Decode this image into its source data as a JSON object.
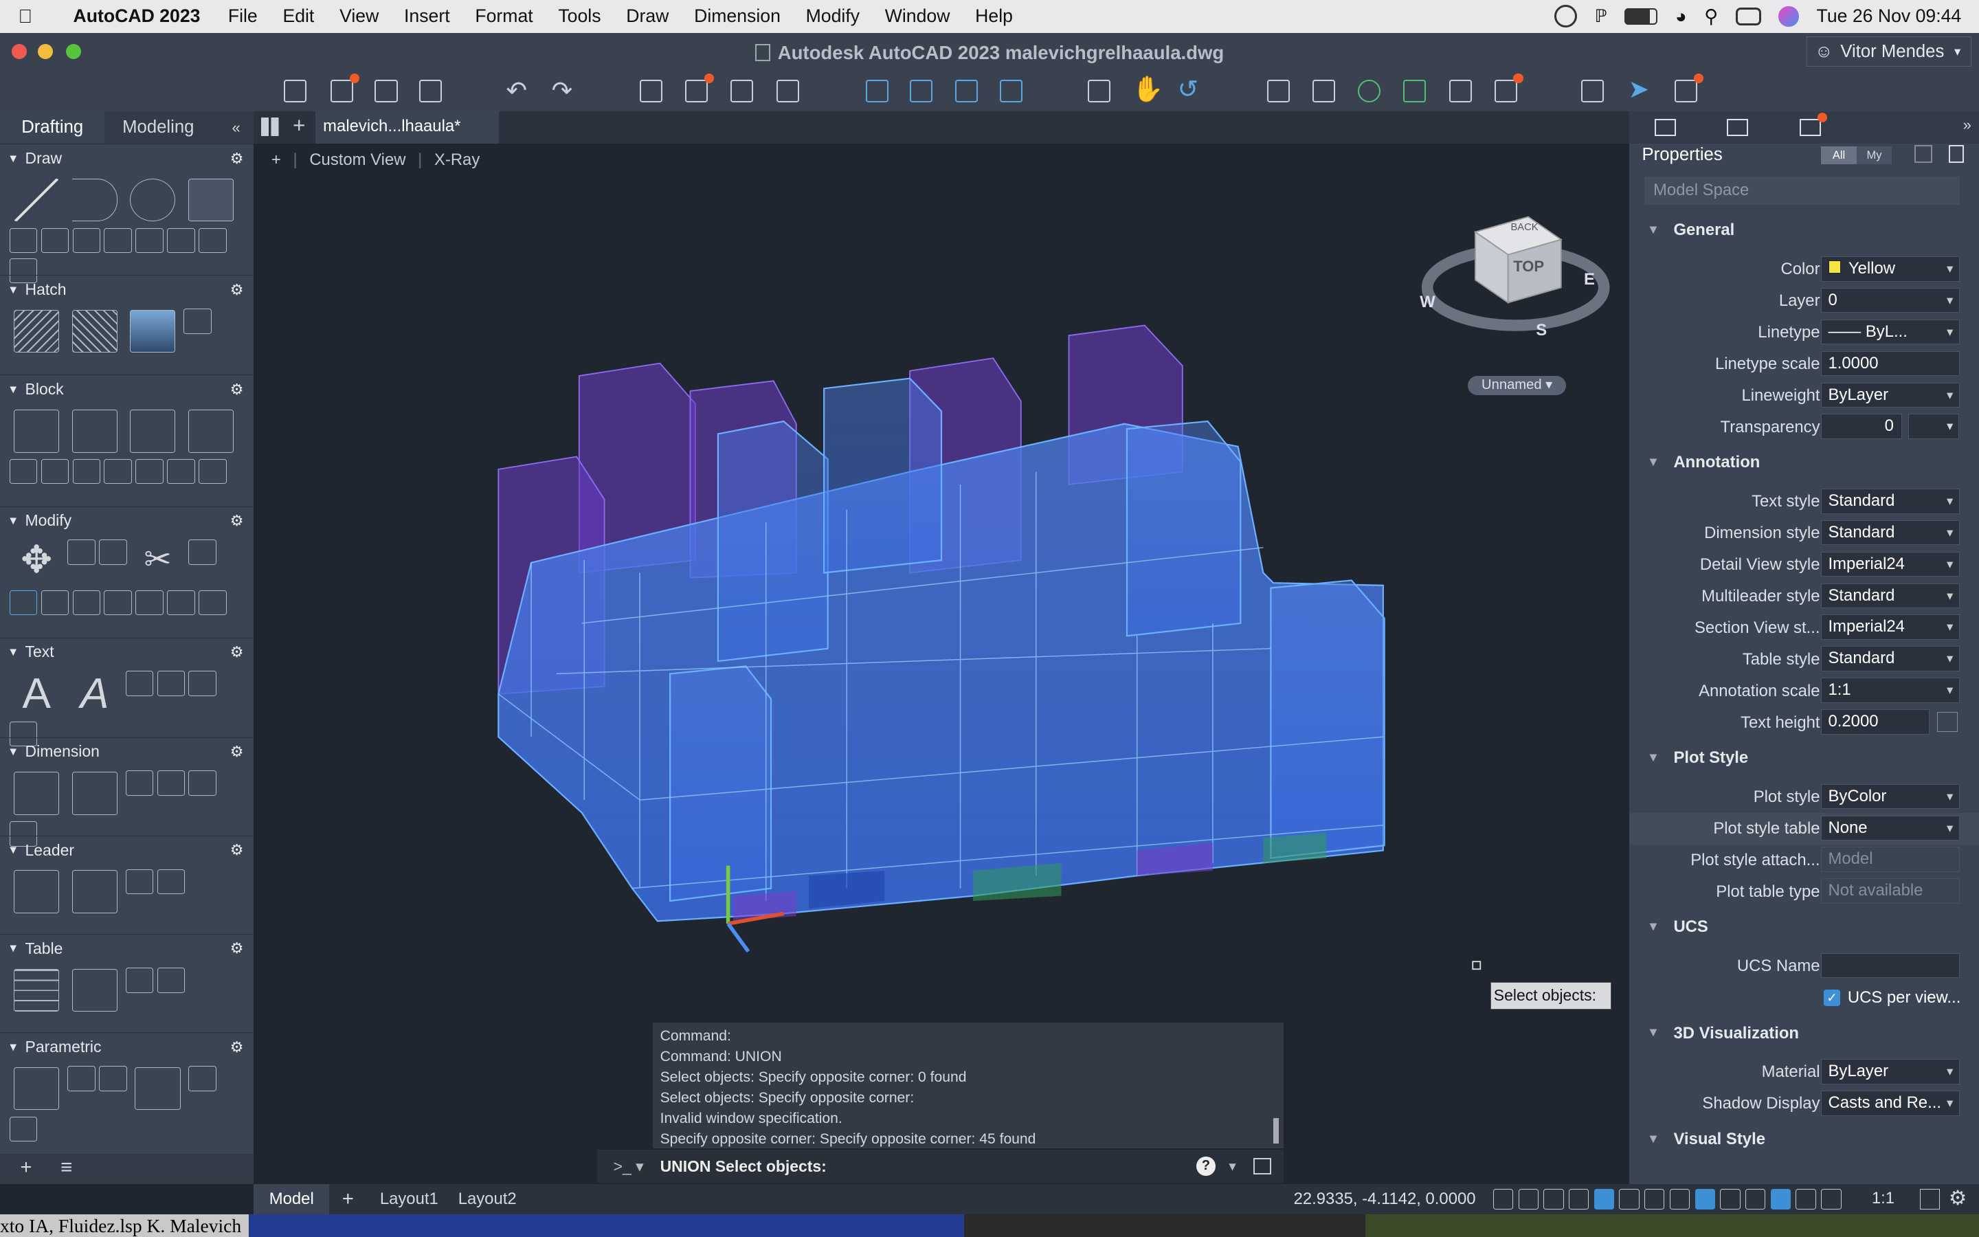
{
  "menubar": {
    "app": "AutoCAD 2023",
    "items": [
      "File",
      "Edit",
      "View",
      "Insert",
      "Format",
      "Tools",
      "Draw",
      "Dimension",
      "Modify",
      "Window",
      "Help"
    ],
    "datetime": "Tue 26 Nov  09:44"
  },
  "window": {
    "title": "Autodesk AutoCAD 2023   malevichgrelhaaula.dwg",
    "user": "Vitor Mendes"
  },
  "palette": {
    "tabs": [
      "Drafting",
      "Modeling"
    ],
    "sections": [
      "Draw",
      "Hatch",
      "Block",
      "Modify",
      "Text",
      "Dimension",
      "Leader",
      "Table",
      "Parametric"
    ]
  },
  "doc": {
    "tab": "malevich...lhaaula*",
    "view_plus": "+",
    "view_name": "Custom View",
    "visual_style": "X-Ray"
  },
  "viewcube": {
    "face": "TOP",
    "back": "BACK",
    "w": "W",
    "s": "S",
    "e": "E",
    "ucs": "Unnamed"
  },
  "command": {
    "history": [
      "Command:",
      "Command: UNION",
      "Select objects: Specify opposite corner: 0 found",
      "Select objects: Specify opposite corner:",
      "Invalid window specification.",
      "Specify opposite corner: Specify opposite corner: 45 found"
    ],
    "prompt": "UNION Select objects:",
    "tooltip": "Select objects:"
  },
  "properties": {
    "title": "Properties",
    "filter_all": "All",
    "filter_my": "My",
    "selector": "Model Space",
    "general": "General",
    "color_label": "Color",
    "color": "Yellow",
    "layer_label": "Layer",
    "layer": "0",
    "linetype_label": "Linetype",
    "linetype": "——  ByL...",
    "ltscale_label": "Linetype scale",
    "ltscale": "1.0000",
    "lweight_label": "Lineweight",
    "lweight": "ByLayer",
    "transp_label": "Transparency",
    "transp": "0",
    "annotation": "Annotation",
    "textstyle_label": "Text style",
    "textstyle": "Standard",
    "dimstyle_label": "Dimension style",
    "dimstyle": "Standard",
    "detail_label": "Detail View style",
    "detail": "Imperial24",
    "mleader_label": "Multileader style",
    "mleader": "Standard",
    "section_label": "Section View st...",
    "section": "Imperial24",
    "table_label": "Table style",
    "table": "Standard",
    "annoscale_label": "Annotation scale",
    "annoscale": "1:1",
    "textheight_label": "Text height",
    "textheight": "0.2000",
    "plotstyle": "Plot Style",
    "pstyle_label": "Plot style",
    "pstyle": "ByColor",
    "pstable_label": "Plot style table",
    "pstable": "None",
    "psattach_label": "Plot style attach...",
    "psattach": "Model",
    "pttype_label": "Plot table type",
    "pttype": "Not available",
    "ucs": "UCS",
    "ucsname_label": "UCS Name",
    "ucsname": "",
    "ucsper": "UCS per view...",
    "vis3d": "3D Visualization",
    "material_label": "Material",
    "material": "ByLayer",
    "shadow_label": "Shadow Display",
    "shadow": "Casts and Re...",
    "visual": "Visual Style"
  },
  "status": {
    "model": "Model",
    "layout1": "Layout1",
    "layout2": "Layout2",
    "coords": "22.9335, -4.1142, 0.0000",
    "scale": "1:1"
  },
  "dock": {
    "text": "xto IA, Fluidez.lsp K. Malevich"
  }
}
